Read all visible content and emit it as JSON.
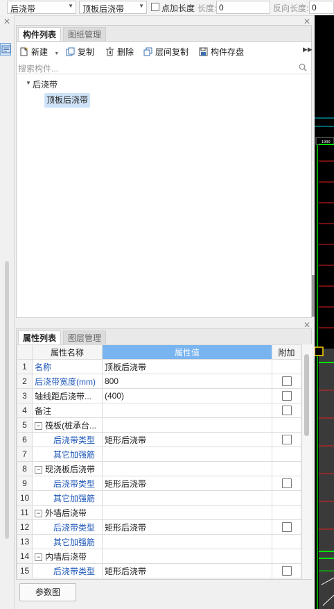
{
  "toolbar": {
    "combo1": "后浇带",
    "combo2": "顶板后浇带",
    "point_length_label": "点加长度",
    "length_label": "长度:",
    "length_value": "0",
    "reverse_length_label": "反向长度:",
    "reverse_length_value": "0"
  },
  "component_panel": {
    "tabs": [
      "构件列表",
      "图纸管理"
    ],
    "buttons": {
      "new": "新建",
      "copy": "复制",
      "delete": "删除",
      "floor_copy": "层间复制",
      "save": "构件存盘"
    },
    "search_placeholder": "搜索构件...",
    "tree": {
      "group": "后浇带",
      "item": "顶板后浇带"
    }
  },
  "property_panel": {
    "tabs": [
      "属性列表",
      "图层管理"
    ],
    "columns": [
      "属性名称",
      "属性值",
      "附加"
    ],
    "rows": [
      {
        "n": "1",
        "name": "名称",
        "value": "顶板后浇带"
      },
      {
        "n": "2",
        "name": "后浇带宽度(mm)",
        "value": "800"
      },
      {
        "n": "3",
        "name": "轴线距后浇带...",
        "value": "(400)"
      },
      {
        "n": "4",
        "name": "备注",
        "value": ""
      },
      {
        "n": "5",
        "name": "筏板(桩承台...",
        "value": ""
      },
      {
        "n": "6",
        "name": "后浇带类型",
        "value": "矩形后浇带"
      },
      {
        "n": "7",
        "name": "其它加强筋",
        "value": ""
      },
      {
        "n": "8",
        "name": "现浇板后浇带",
        "value": ""
      },
      {
        "n": "9",
        "name": "后浇带类型",
        "value": "矩形后浇带"
      },
      {
        "n": "10",
        "name": "其它加强筋",
        "value": ""
      },
      {
        "n": "11",
        "name": "外墙后浇带",
        "value": ""
      },
      {
        "n": "12",
        "name": "后浇带类型",
        "value": "矩形后浇带"
      },
      {
        "n": "13",
        "name": "其它加强筋",
        "value": ""
      },
      {
        "n": "14",
        "name": "内墙后浇带",
        "value": ""
      },
      {
        "n": "15",
        "name": "后浇带类型",
        "value": "矩形后浇带"
      }
    ],
    "param_button": "参数图"
  },
  "canvas": {
    "label": "1990"
  },
  "colors": {
    "accent": "#78b4f0",
    "selected": "#cfe3f8",
    "link": "#1c56b8"
  }
}
